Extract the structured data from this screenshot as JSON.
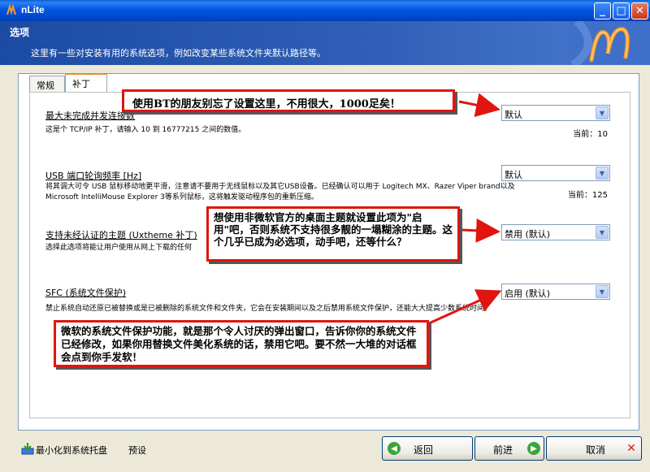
{
  "window": {
    "title": "nLite"
  },
  "header": {
    "title": "选项",
    "subtitle": "这里有一些对安装有用的系统选项，例如改变某些系统文件夹默认路径等。"
  },
  "tabs": [
    {
      "label": "常规",
      "active": false
    },
    {
      "label": "补丁",
      "active": true
    }
  ],
  "options": [
    {
      "label": "最大未完成并发连接数",
      "description": "这是个 TCP/IP 补丁，请输入 10 到 16777215 之间的数值。",
      "value": "默认",
      "current": "当前：10"
    },
    {
      "label": "USB 端口轮询频率 [Hz]",
      "description": "将其调大可令 USB 鼠标移动地更平滑，注意请不要用于无线鼠标以及其它USB设备。已经确认可以用于 Logitech MX、Razer Viper brand以及 Microsoft IntelliMouse Explorer 3等系列鼠标，这将触发驱动程序包的重新压缩。",
      "value": "默认",
      "current": "当前：125"
    },
    {
      "label": "支持未经认证的主题 (Uxtheme 补丁)",
      "description": "选择此选项将能让用户使用从网上下载的任何",
      "value": "禁用 (默认)",
      "current": ""
    },
    {
      "label": "SFC (系统文件保护)",
      "description": "禁止系统自动还原已被替换或是已被删除的系统文件和文件夹，它会在安装期间以及之后禁用系统文件保护，还能大大提高少数系统时间。",
      "value": "启用 (默认)",
      "current": ""
    }
  ],
  "callouts": {
    "bt": "使用BT的朋友别忘了设置这里，不用很大，1000足矣！",
    "theme": "想使用非微软官方的桌面主题就设置此项为\"启用\"吧，否则系统不支持很多靓的一塌糊涂的主题。这个几乎已成为必选项，动手吧，还等什么？",
    "sfc": "微软的系统文件保护功能，就是那个令人讨厌的弹出窗口，告诉你你的系统文件已经修改，如果你用替换文件美化系统的话，禁用它吧。要不然一大堆的对话框会点到你手发软！"
  },
  "footer": {
    "minimize_label": "最小化到系统托盘",
    "preset_label": "预设",
    "back_label": "返回",
    "next_label": "前进",
    "cancel_label": "取消"
  },
  "colors": {
    "callout_border": "#e0150f",
    "titlebar": "#0055e5",
    "header": "#2a56a8"
  }
}
